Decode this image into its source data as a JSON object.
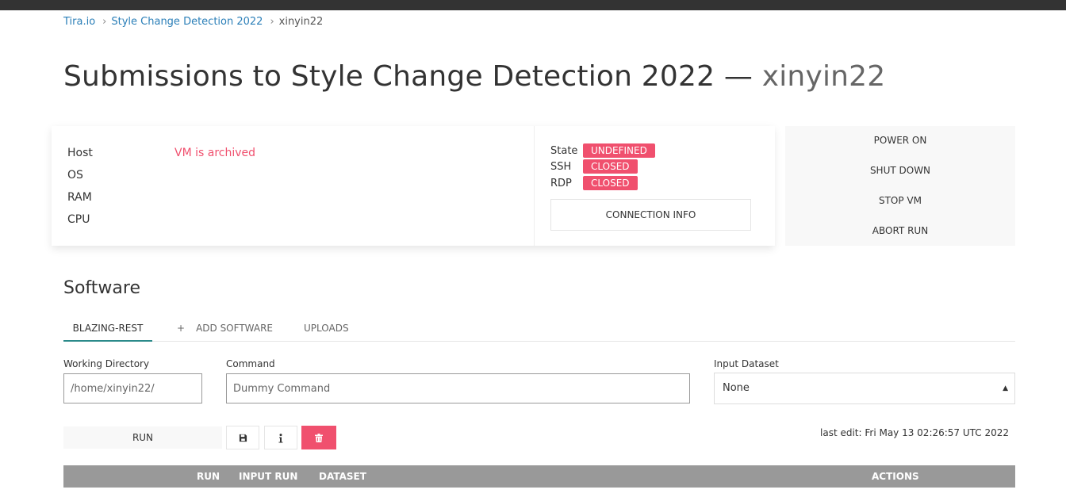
{
  "breadcrumb": {
    "items": [
      {
        "label": "Tira.io"
      },
      {
        "label": "Style Change Detection 2022"
      },
      {
        "label": "xinyin22"
      }
    ],
    "separator": "›"
  },
  "page": {
    "title": "Submissions to Style Change Detection 2022 —",
    "user": "xinyin22"
  },
  "vm_info": {
    "host_label": "Host",
    "host_value": "VM is archived",
    "os_label": "OS",
    "ram_label": "RAM",
    "cpu_label": "CPU"
  },
  "vm_state": {
    "state_label": "State",
    "state_value": "UNDEFINED",
    "ssh_label": "SSH",
    "ssh_value": "CLOSED",
    "rdp_label": "RDP",
    "rdp_value": "CLOSED",
    "connection_info": "CONNECTION INFO"
  },
  "vm_actions": {
    "power_on": "POWER ON",
    "shut_down": "SHUT DOWN",
    "stop_vm": "STOP VM",
    "abort_run": "ABORT RUN"
  },
  "software": {
    "section_title": "Software",
    "tabs": {
      "active": "BLAZING-REST",
      "add_plus": "+",
      "add": "ADD SOFTWARE",
      "uploads": "UPLOADS"
    },
    "working_directory_label": "Working Directory",
    "working_directory_value": "/home/xinyin22/",
    "command_label": "Command",
    "command_value": "Dummy Command",
    "input_dataset_label": "Input Dataset",
    "input_dataset_value": "None",
    "run_label": "RUN",
    "last_edit": "last edit: Fri May 13 02:26:57 UTC 2022"
  },
  "table": {
    "headers": [
      "RUN",
      "INPUT RUN",
      "DATASET",
      "ACTIONS"
    ]
  },
  "colors": {
    "accent_danger": "#f0506e",
    "link": "#2b7fb8",
    "header_gray": "#999999",
    "topbar": "#333333"
  },
  "icons": {
    "save": "save-icon",
    "info": "info-icon",
    "delete": "trash-icon",
    "select_arrow": "select-arrows-icon"
  }
}
